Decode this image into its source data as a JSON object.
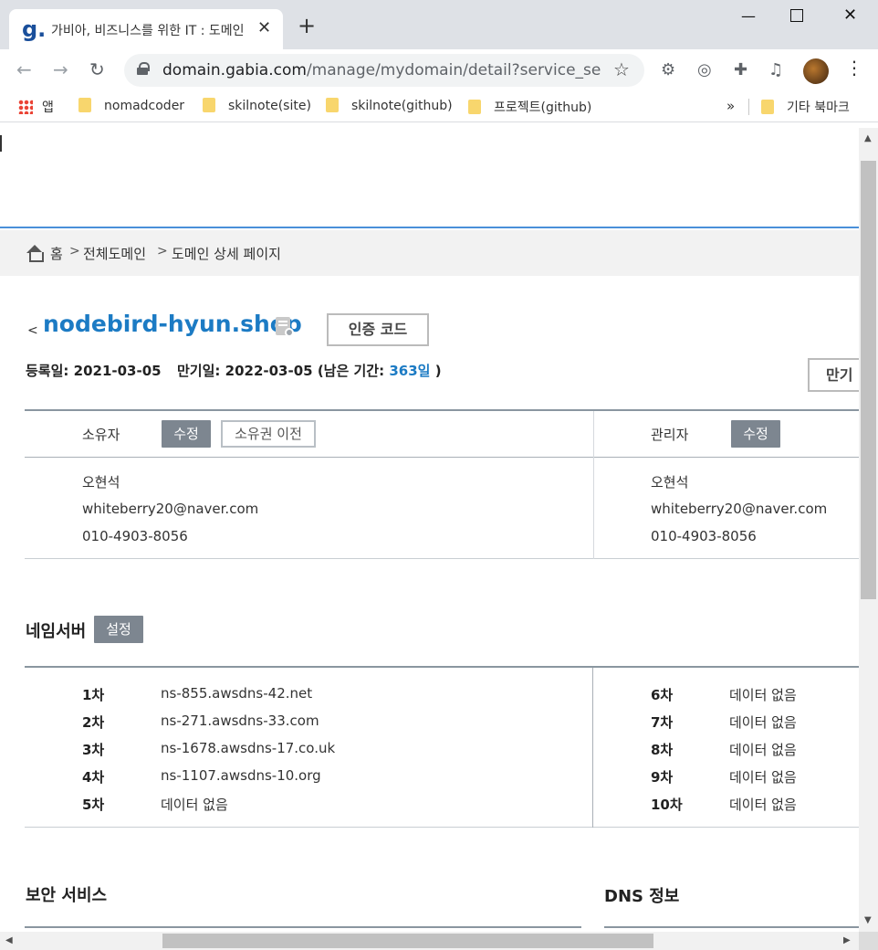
{
  "browser": {
    "tab_title": "가비아, 비즈니스를 위한 IT : 도메인",
    "favicon": "g.",
    "url_host": "domain.gabia.com",
    "url_path": "/manage/mydomain/detail?service_seq...",
    "bookmarks": [
      {
        "label": "앱",
        "icon": "apps-icon"
      },
      {
        "label": "nomadcoder",
        "icon": "folder-icon"
      },
      {
        "label": "skilnote(site)",
        "icon": "folder-icon"
      },
      {
        "label": "skilnote(github)",
        "icon": "folder-icon"
      },
      {
        "label": "프로젝트(github)",
        "icon": "folder-icon"
      }
    ],
    "bookmarks_overflow": "»",
    "other_bookmarks": "기타 북마크"
  },
  "breadcrumb": {
    "home": "홈",
    "all_domains": "전체도메인",
    "current": "도메인 상세 페이지",
    "separator": ">"
  },
  "domain": {
    "back": "<",
    "name": "nodebird-hyun.shop",
    "auth_code_button": "인증 코드",
    "reg_label": "등록일:",
    "reg_date": "2021-03-05",
    "exp_label": "만기일:",
    "exp_date": "2022-03-05",
    "remaining_prefix": "(남은 기간:",
    "remaining_days": "363일",
    "remaining_suffix": ")",
    "expiry_button": "만기"
  },
  "owner": {
    "label": "소유자",
    "edit_button": "수정",
    "transfer_button": "소유권 이전",
    "name": "오현석",
    "email": "whiteberry20@naver.com",
    "phone": "010-4903-8056"
  },
  "admin": {
    "label": "관리자",
    "edit_button": "수정",
    "name": "오현석",
    "email": "whiteberry20@naver.com",
    "phone": "010-4903-8056"
  },
  "nameserver": {
    "title": "네임서버",
    "setup_button": "설정",
    "left": [
      {
        "num": "1차",
        "value": "ns-855.awsdns-42.net"
      },
      {
        "num": "2차",
        "value": "ns-271.awsdns-33.com"
      },
      {
        "num": "3차",
        "value": "ns-1678.awsdns-17.co.uk"
      },
      {
        "num": "4차",
        "value": "ns-1107.awsdns-10.org"
      },
      {
        "num": "5차",
        "value": "데이터 없음"
      }
    ],
    "right": [
      {
        "num": "6차",
        "value": "데이터 없음"
      },
      {
        "num": "7차",
        "value": "데이터 없음"
      },
      {
        "num": "8차",
        "value": "데이터 없음"
      },
      {
        "num": "9차",
        "value": "데이터 없음"
      },
      {
        "num": "10차",
        "value": "데이터 없음"
      }
    ]
  },
  "security": {
    "title": "보안 서비스"
  },
  "dns": {
    "title": "DNS 정보"
  }
}
